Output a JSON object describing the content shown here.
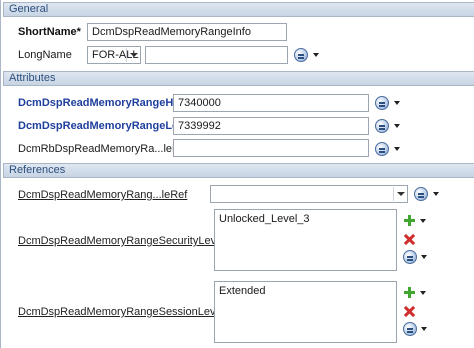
{
  "general": {
    "header": "General",
    "shortname_label": "ShortName*",
    "shortname_value": "DcmDspReadMemoryRangeInfo",
    "longname_label": "LongName",
    "longname_lang": "FOR-ALL",
    "longname_value": ""
  },
  "attributes": {
    "header": "Attributes",
    "high_label": "DcmDspReadMemoryRangeHigh*",
    "high_value": "7340000",
    "low_label": "DcmDspReadMemoryRangeLow*",
    "low_value": "7339992",
    "fnc_label": "DcmRbDspReadMemoryRa...leFnc",
    "fnc_value": ""
  },
  "references": {
    "header": "References",
    "ref1_label": "DcmDspReadMemoryRang...leRef",
    "ref1_value": "",
    "security_label": "DcmDspReadMemoryRangeSecurityLevelRef",
    "security_value": "Unlocked_Level_3",
    "session_label": "DcmDspReadMemoryRangeSessionLevelRef",
    "session_value": "Extended"
  },
  "icons": [
    "reference-icon",
    "dropdown-arrow-icon",
    "add-icon",
    "delete-icon"
  ]
}
